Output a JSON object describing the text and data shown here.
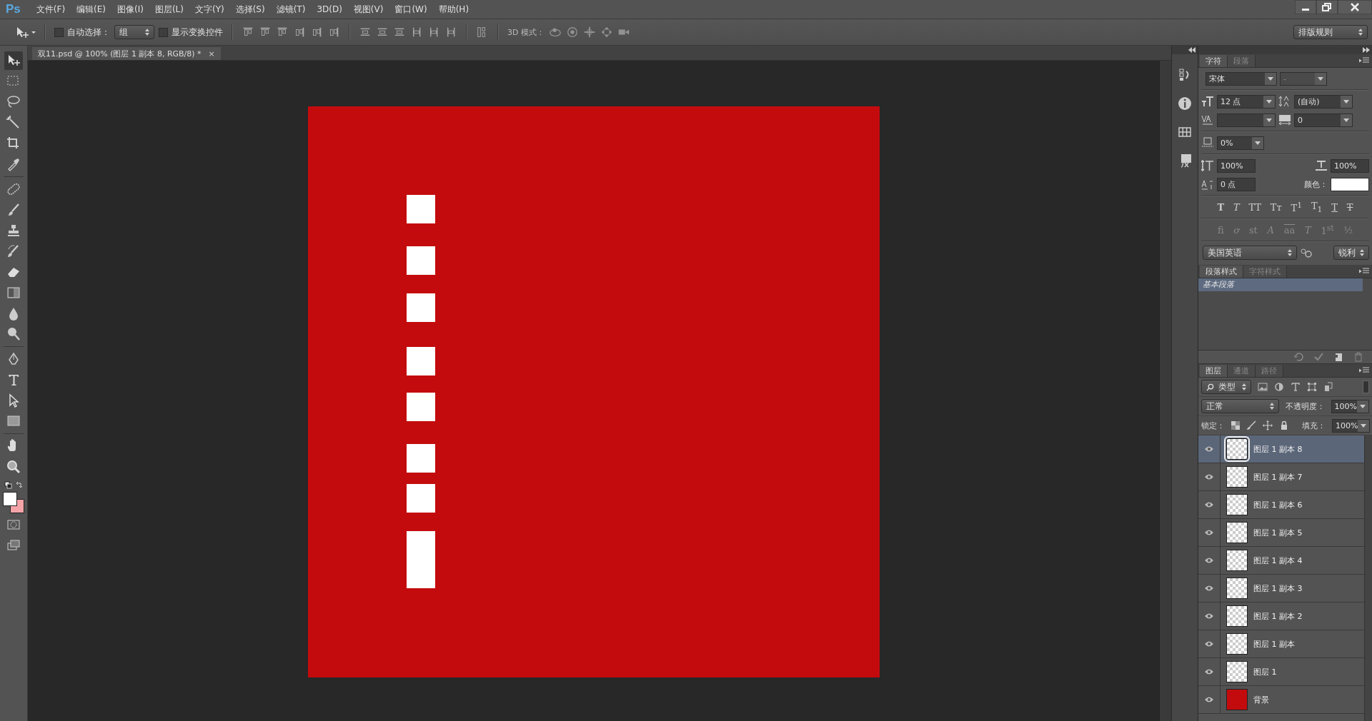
{
  "app": {
    "logo": "Ps"
  },
  "menu": [
    "文件(F)",
    "编辑(E)",
    "图像(I)",
    "图层(L)",
    "文字(Y)",
    "选择(S)",
    "滤镜(T)",
    "3D(D)",
    "视图(V)",
    "窗口(W)",
    "帮助(H)"
  ],
  "options_bar": {
    "auto_select": {
      "label": "自动选择：",
      "checked": false
    },
    "auto_select_target": "组",
    "show_transform": {
      "label": "显示变换控件",
      "checked": false
    },
    "mode_3d_label": "3D 模式：",
    "workspace": "排版规则"
  },
  "document_tab": {
    "title": "双11.psd @ 100% (图层 1 副本 8, RGB/8) *",
    "close": "×"
  },
  "tools": [
    {
      "kind": "move",
      "selected": true
    },
    {
      "kind": "marquee",
      "selected": false
    },
    {
      "kind": "lasso",
      "selected": false
    },
    {
      "kind": "wand",
      "selected": false
    },
    {
      "kind": "crop",
      "selected": false
    },
    {
      "kind": "eyedropper",
      "selected": false
    },
    {
      "kind": "heal",
      "selected": false
    },
    {
      "kind": "brush",
      "selected": false
    },
    {
      "kind": "stamp",
      "selected": false
    },
    {
      "kind": "history",
      "selected": false
    },
    {
      "kind": "eraser",
      "selected": false
    },
    {
      "kind": "gradient",
      "selected": false
    },
    {
      "kind": "blur",
      "selected": false
    },
    {
      "kind": "dodge",
      "selected": false
    },
    {
      "kind": "pen",
      "selected": false
    },
    {
      "kind": "type",
      "selected": false
    },
    {
      "kind": "path-select",
      "selected": false
    },
    {
      "kind": "shape",
      "selected": false
    },
    {
      "kind": "hand",
      "selected": false
    },
    {
      "kind": "zoom",
      "selected": false
    }
  ],
  "swatches": [
    {
      "color": "#ffffff"
    },
    {
      "color": "#f4a4a8"
    }
  ],
  "character_panel": {
    "tabs": [
      {
        "label": "字符",
        "selected": true
      },
      {
        "label": "段落",
        "selected": false
      }
    ],
    "font_family": "宋体",
    "font_style": "-",
    "font_size": "12 点",
    "leading": "(自动)",
    "tracking": "0",
    "tsume": "0%",
    "vertical_scale": "100%",
    "horizontal_scale": "100%",
    "baseline_shift": "0 点",
    "color_label": "颜色：",
    "style_buttons": [
      {
        "kind": "bold",
        "label": "T"
      },
      {
        "kind": "italic",
        "label": "T"
      },
      {
        "kind": "caps",
        "label": "TT"
      },
      {
        "kind": "caps",
        "label": "Tᴛ"
      },
      {
        "kind": "plain",
        "label": "T$^{1}$"
      },
      {
        "kind": "plain",
        "label": "T$_{1}$"
      },
      {
        "kind": "underline",
        "label": "T"
      },
      {
        "kind": "strike",
        "label": "T"
      }
    ],
    "opentype_buttons": [
      {
        "kind": "plain",
        "label": "fi"
      },
      {
        "kind": "italic",
        "label": "ơ"
      },
      {
        "kind": "plain",
        "label": "st"
      },
      {
        "kind": "italic",
        "label": "A"
      },
      {
        "kind": "overline",
        "label": "aa"
      },
      {
        "kind": "italic",
        "label": "T"
      },
      {
        "kind": "plain",
        "label": "1$^{st}$"
      },
      {
        "kind": "plain",
        "label": "½"
      }
    ],
    "language": "美国英语",
    "antialias": "锐利"
  },
  "paragraph_styles_panel": {
    "tabs": [
      {
        "label": "段落样式",
        "selected": true
      },
      {
        "label": "字符样式",
        "selected": false
      }
    ],
    "items": [
      {
        "label": "基本段落",
        "selected": true
      }
    ]
  },
  "layers_panel": {
    "tabs": [
      {
        "label": "图层",
        "selected": true
      },
      {
        "label": "通道",
        "selected": false
      },
      {
        "label": "路径",
        "selected": false
      }
    ],
    "filter": "类型",
    "blend_mode": "正常",
    "opacity_label": "不透明度：",
    "opacity": "100%",
    "lock_label": "锁定：",
    "fill_label": "填充：",
    "fill": "100%",
    "layers": [
      {
        "name": "图层 1 副本 8",
        "kind": "transparent",
        "visible": true,
        "selected": true
      },
      {
        "name": "图层 1 副本 7",
        "kind": "transparent",
        "visible": true,
        "selected": false
      },
      {
        "name": "图层 1 副本 6",
        "kind": "transparent",
        "visible": true,
        "selected": false
      },
      {
        "name": "图层 1 副本 5",
        "kind": "transparent",
        "visible": true,
        "selected": false
      },
      {
        "name": "图层 1 副本 4",
        "kind": "transparent",
        "visible": true,
        "selected": false
      },
      {
        "name": "图层 1 副本 3",
        "kind": "transparent",
        "visible": true,
        "selected": false
      },
      {
        "name": "图层 1 副本 2",
        "kind": "transparent",
        "visible": true,
        "selected": false
      },
      {
        "name": "图层 1 副本",
        "kind": "transparent",
        "visible": true,
        "selected": false
      },
      {
        "name": "图层 1",
        "kind": "transparent",
        "visible": true,
        "selected": false
      },
      {
        "name": "背景",
        "kind": "fill",
        "visible": true,
        "selected": false
      }
    ]
  }
}
